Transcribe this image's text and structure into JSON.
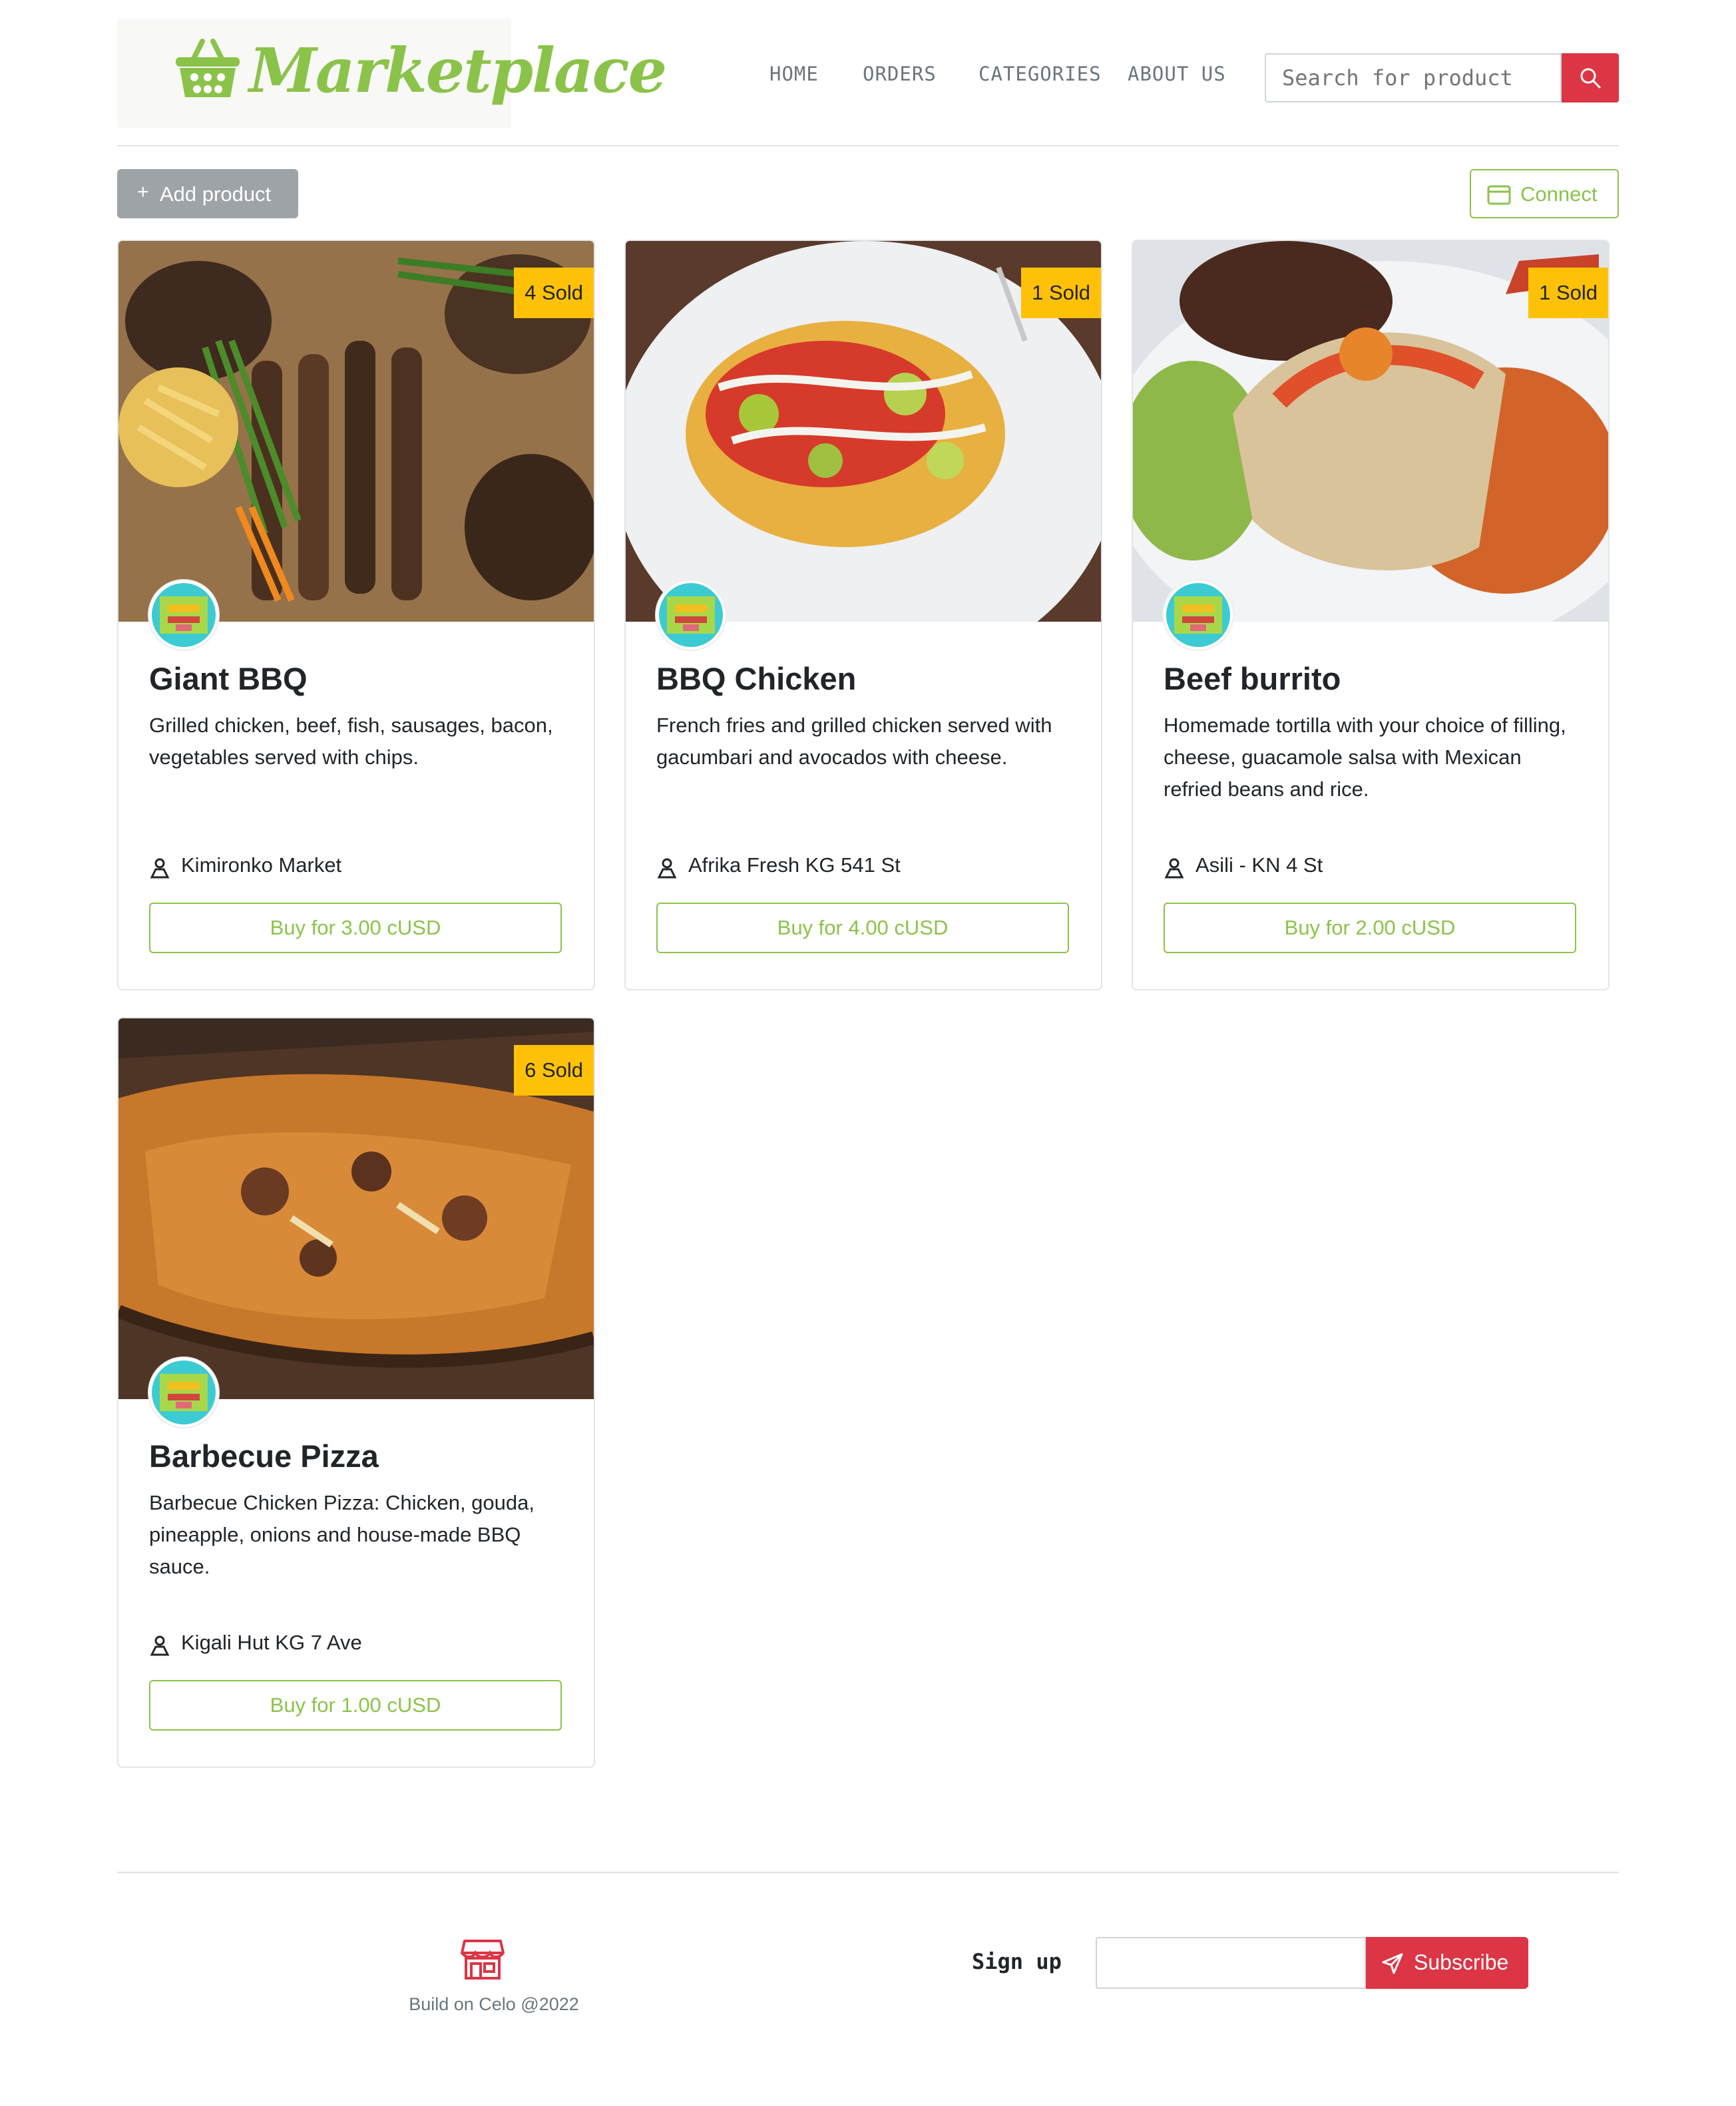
{
  "header": {
    "logo_text": "Marketplace",
    "nav": [
      "HOME",
      "ORDERS",
      "CATEGORIES",
      "ABOUT US"
    ],
    "search_placeholder": "Search for product",
    "search_icon": "search-icon"
  },
  "toolbar": {
    "add_label": "Add product",
    "connect_label": "Connect"
  },
  "products": [
    {
      "name": "Giant BBQ",
      "sold": "4 Sold",
      "description": "Grilled chicken, beef, fish, sausages, bacon, vegetables served with chips.",
      "location": "Kimironko Market",
      "buy": "Buy for 3.00 cUSD"
    },
    {
      "name": "BBQ Chicken",
      "sold": "1 Sold",
      "description": "French fries and grilled chicken served with gacumbari and avocados with cheese.",
      "location": "Afrika Fresh KG 541 St",
      "buy": "Buy for 4.00 cUSD"
    },
    {
      "name": "Beef burrito",
      "sold": "1 Sold",
      "description": "Homemade tortilla with your choice of filling, cheese, guacamole salsa with Mexican refried beans and rice.",
      "location": "Asili - KN 4 St",
      "buy": "Buy for 2.00 cUSD"
    },
    {
      "name": "Barbecue Pizza",
      "sold": "6 Sold",
      "description": "Barbecue Chicken Pizza: Chicken, gouda, pineapple, onions and house-made BBQ sauce.",
      "location": "Kigali Hut KG 7 Ave",
      "buy": "Buy for 1.00 cUSD"
    }
  ],
  "footer": {
    "note": "Build on Celo @2022",
    "signup_label": "Sign up",
    "subscribe_label": "Subscribe"
  },
  "colors": {
    "accent": "#8bc34a",
    "danger": "#dc3545",
    "badge": "#ffc107"
  }
}
